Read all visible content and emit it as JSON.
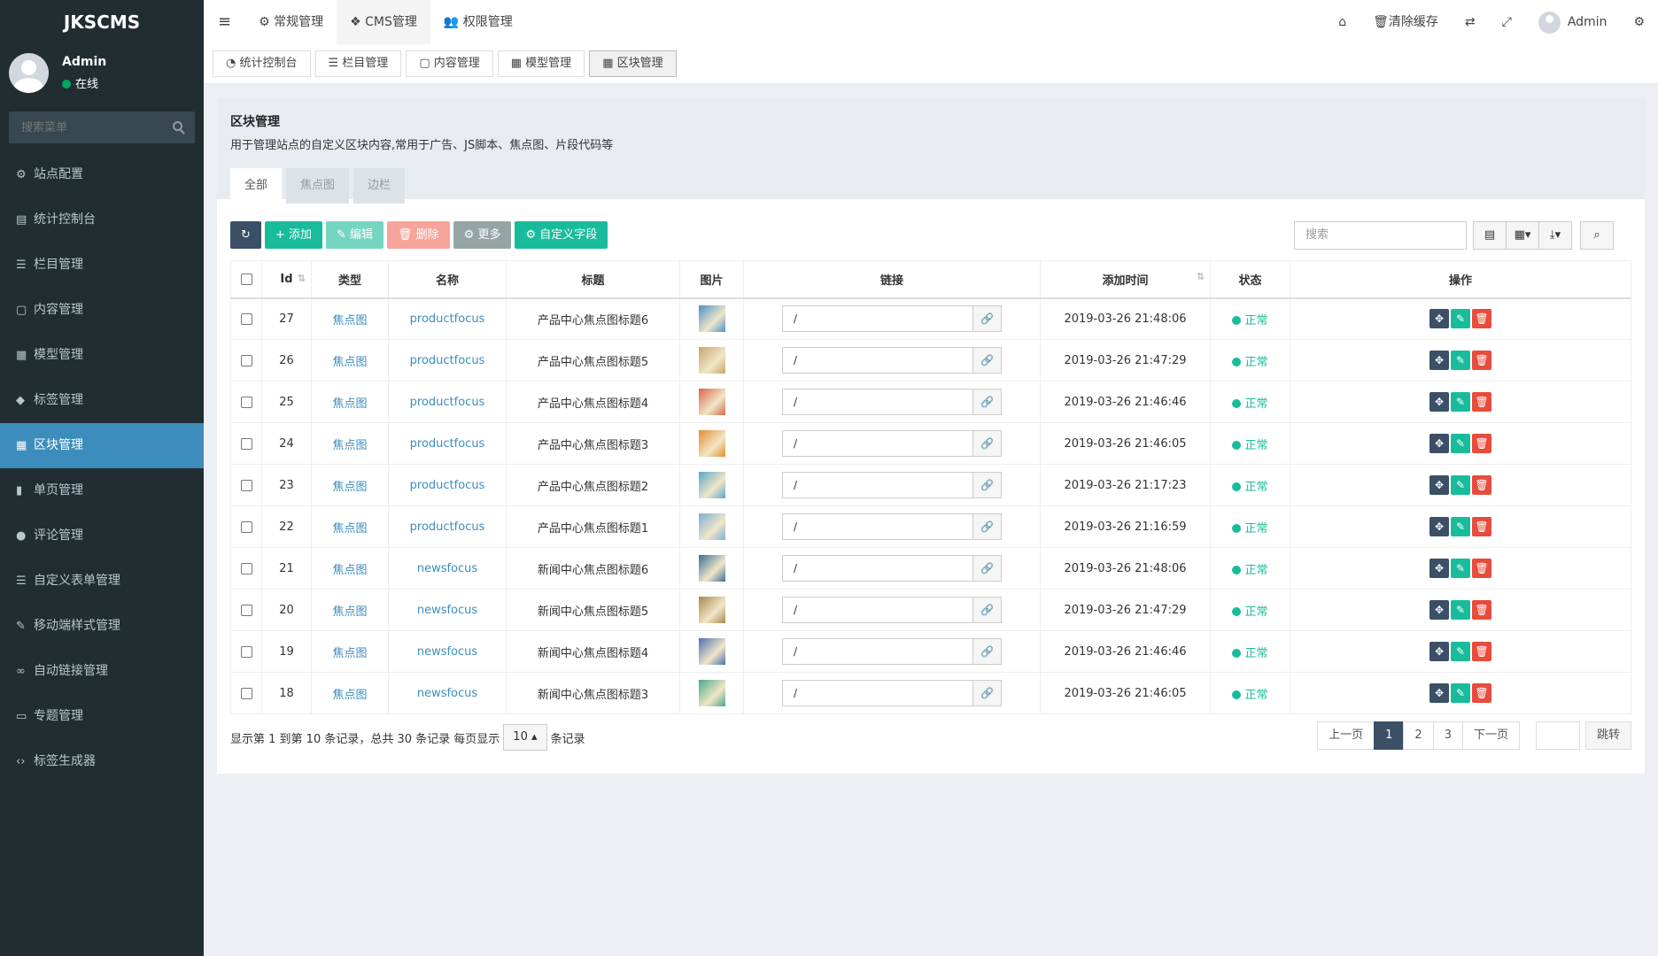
{
  "sidebar": {
    "logo": "JKSCMS",
    "user": {
      "name": "Admin",
      "status": "在线"
    },
    "search_placeholder": "搜索菜单",
    "items": [
      {
        "label": "站点配置",
        "icon": "⚙"
      },
      {
        "label": "统计控制台",
        "icon": "▤"
      },
      {
        "label": "栏目管理",
        "icon": "☰"
      },
      {
        "label": "内容管理",
        "icon": "▢"
      },
      {
        "label": "模型管理",
        "icon": "▦"
      },
      {
        "label": "标签管理",
        "icon": "◆"
      },
      {
        "label": "区块管理",
        "icon": "▦"
      },
      {
        "label": "单页管理",
        "icon": "▮"
      },
      {
        "label": "评论管理",
        "icon": "●"
      },
      {
        "label": "自定义表单管理",
        "icon": "☰"
      },
      {
        "label": "移动端样式管理",
        "icon": "✎"
      },
      {
        "label": "自动链接管理",
        "icon": "∞"
      },
      {
        "label": "专题管理",
        "icon": "▭"
      },
      {
        "label": "标签生成器",
        "icon": "‹›"
      }
    ]
  },
  "topnav": {
    "items": [
      "常规管理",
      "CMS管理",
      "权限管理"
    ],
    "clear_cache": "清除缓存",
    "user": "Admin"
  },
  "tabs": [
    "统计控制台",
    "栏目管理",
    "内容管理",
    "模型管理",
    "区块管理"
  ],
  "panel": {
    "title": "区块管理",
    "desc": "用于管理站点的自定义区块内容,常用于广告、JS脚本、焦点图、片段代码等",
    "subtabs": [
      "全部",
      "焦点图",
      "边栏"
    ]
  },
  "toolbar": {
    "add": "添加",
    "edit": "编辑",
    "delete": "删除",
    "more": "更多",
    "custom": "自定义字段",
    "search_placeholder": "搜索"
  },
  "table": {
    "headers": [
      "Id",
      "类型",
      "名称",
      "标题",
      "图片",
      "链接",
      "添加时间",
      "状态",
      "操作"
    ],
    "rows": [
      {
        "id": "27",
        "type": "焦点图",
        "name": "productfocus",
        "title": "产品中心焦点图标题6",
        "link": "/",
        "time": "2019-03-26 21:48:06",
        "status": "正常",
        "color": "#4a90c8"
      },
      {
        "id": "26",
        "type": "焦点图",
        "name": "productfocus",
        "title": "产品中心焦点图标题5",
        "link": "/",
        "time": "2019-03-26 21:47:29",
        "status": "正常",
        "color": "#c9a46a"
      },
      {
        "id": "25",
        "type": "焦点图",
        "name": "productfocus",
        "title": "产品中心焦点图标题4",
        "link": "/",
        "time": "2019-03-26 21:46:46",
        "status": "正常",
        "color": "#d9664a"
      },
      {
        "id": "24",
        "type": "焦点图",
        "name": "productfocus",
        "title": "产品中心焦点图标题3",
        "link": "/",
        "time": "2019-03-26 21:46:05",
        "status": "正常",
        "color": "#e58a2b"
      },
      {
        "id": "23",
        "type": "焦点图",
        "name": "productfocus",
        "title": "产品中心焦点图标题2",
        "link": "/",
        "time": "2019-03-26 21:17:23",
        "status": "正常",
        "color": "#5ba6c9"
      },
      {
        "id": "22",
        "type": "焦点图",
        "name": "productfocus",
        "title": "产品中心焦点图标题1",
        "link": "/",
        "time": "2019-03-26 21:16:59",
        "status": "正常",
        "color": "#7ab0d8"
      },
      {
        "id": "21",
        "type": "焦点图",
        "name": "newsfocus",
        "title": "新闻中心焦点图标题6",
        "link": "/",
        "time": "2019-03-26 21:48:06",
        "status": "正常",
        "color": "#3a6f9a"
      },
      {
        "id": "20",
        "type": "焦点图",
        "name": "newsfocus",
        "title": "新闻中心焦点图标题5",
        "link": "/",
        "time": "2019-03-26 21:47:29",
        "status": "正常",
        "color": "#a8884a"
      },
      {
        "id": "19",
        "type": "焦点图",
        "name": "newsfocus",
        "title": "新闻中心焦点图标题4",
        "link": "/",
        "time": "2019-03-26 21:46:46",
        "status": "正常",
        "color": "#4a6fb0"
      },
      {
        "id": "18",
        "type": "焦点图",
        "name": "newsfocus",
        "title": "新闻中心焦点图标题3",
        "link": "/",
        "time": "2019-03-26 21:46:05",
        "status": "正常",
        "color": "#4aa88a"
      }
    ]
  },
  "pagination": {
    "info_pre": "显示第 1 到第 10 条记录，总共 30 条记录 每页显示",
    "page_size": "10",
    "info_post": "条记录",
    "prev": "上一页",
    "pages": [
      "1",
      "2",
      "3"
    ],
    "next": "下一页",
    "jump": "跳转"
  },
  "colors": {
    "sidebar": "#222d32",
    "active": "#3c8dbc",
    "green": "#18bc9c",
    "dark": "#3b4f66",
    "red": "#e74c3c"
  }
}
